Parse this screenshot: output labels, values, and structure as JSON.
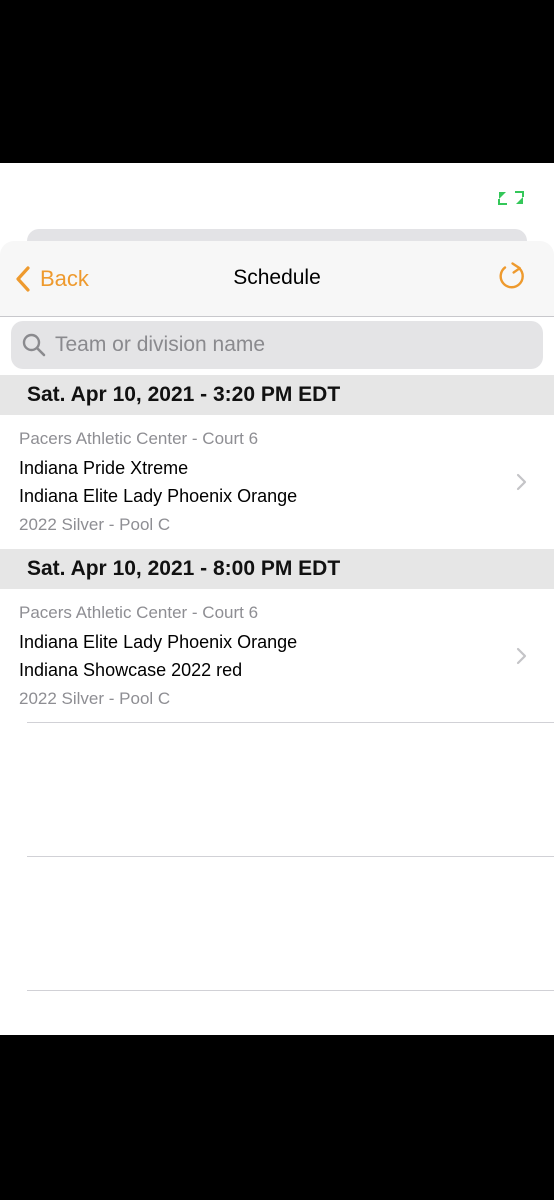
{
  "nav": {
    "back_label": "Back",
    "title": "Schedule"
  },
  "search": {
    "placeholder": "Team or division name"
  },
  "sections": [
    {
      "header": "Sat. Apr 10, 2021 - 3:20 PM EDT",
      "game": {
        "venue": "Pacers Athletic Center - Court 6",
        "team1": "Indiana Pride Xtreme",
        "team2": "Indiana Elite Lady Phoenix Orange",
        "division": "2022 Silver - Pool C"
      }
    },
    {
      "header": "Sat. Apr 10, 2021 - 8:00 PM EDT",
      "game": {
        "venue": "Pacers Athletic Center - Court 6",
        "team1": "Indiana Elite Lady Phoenix Orange",
        "team2": "Indiana Showcase 2022 red",
        "division": "2022 Silver - Pool C"
      }
    }
  ],
  "colors": {
    "accent": "#ee9a2e",
    "secondary_text": "#8e8e93",
    "section_bg": "#e6e6e6",
    "expand_icon": "#34c759"
  },
  "icons": [
    "expand-icon",
    "back-chevron-icon",
    "refresh-icon",
    "search-icon",
    "chevron-right-icon"
  ]
}
